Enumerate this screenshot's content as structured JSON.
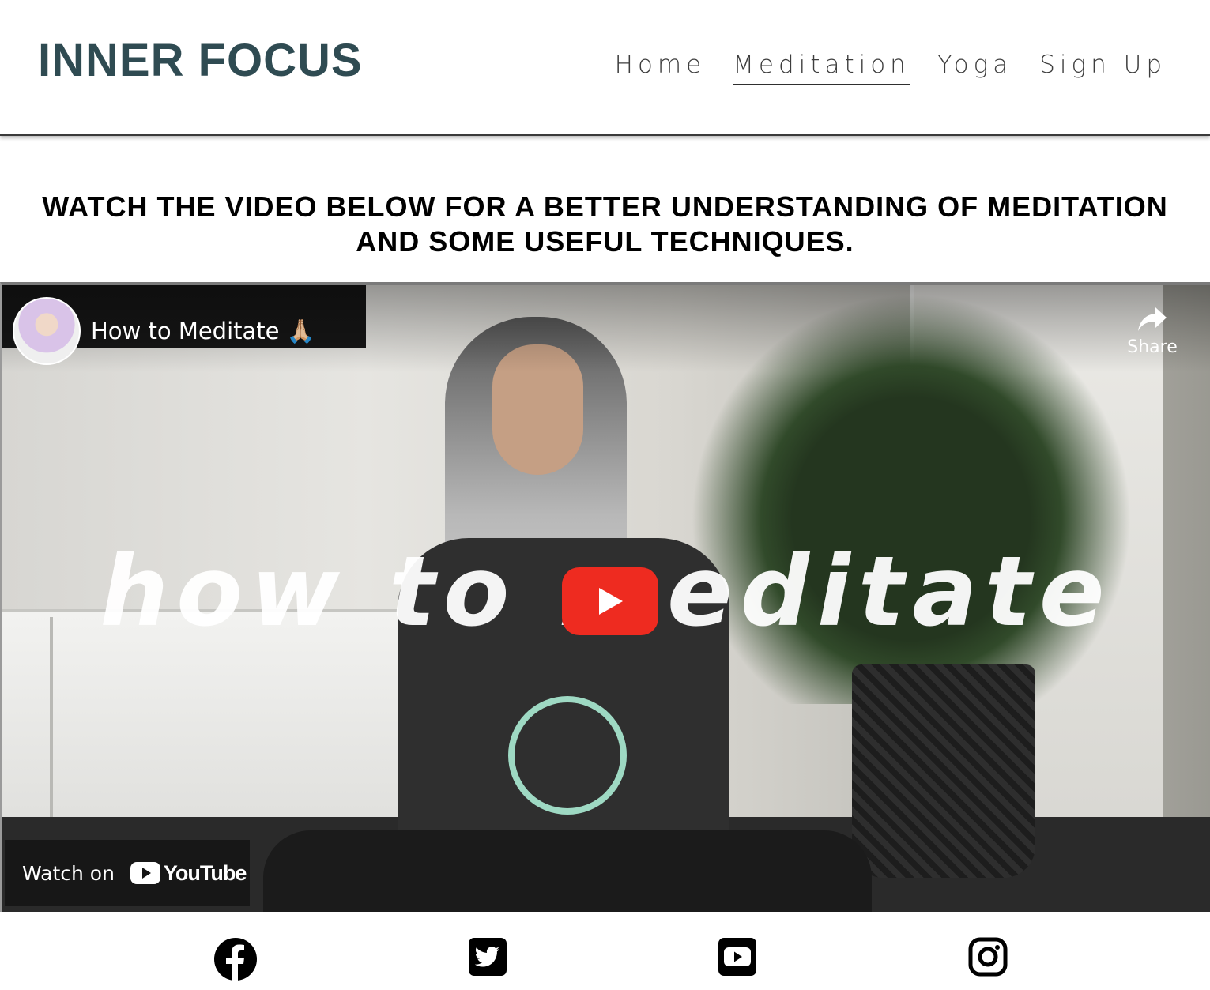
{
  "header": {
    "brand": "INNER FOCUS",
    "nav": [
      {
        "label": "Home",
        "active": false
      },
      {
        "label": "Meditation",
        "active": true
      },
      {
        "label": "Yoga",
        "active": false
      },
      {
        "label": "Sign Up",
        "active": false
      }
    ]
  },
  "intro": {
    "line1": "WATCH THE VIDEO BELOW FOR A BETTER UNDERSTANDING OF MEDITATION",
    "line2": "AND SOME USEFUL TECHNIQUES."
  },
  "video": {
    "title": "How to Meditate 🙏🏼",
    "share_label": "Share",
    "overlay_text": "how to meditate",
    "watch_on": "Watch on",
    "youtube_word": "YouTube",
    "play_color": "#ee2b20"
  },
  "social": [
    {
      "name": "facebook-icon"
    },
    {
      "name": "twitter-icon"
    },
    {
      "name": "youtube-icon"
    },
    {
      "name": "instagram-icon"
    }
  ],
  "colors": {
    "brand": "#2f4b52",
    "text": "#000000"
  }
}
